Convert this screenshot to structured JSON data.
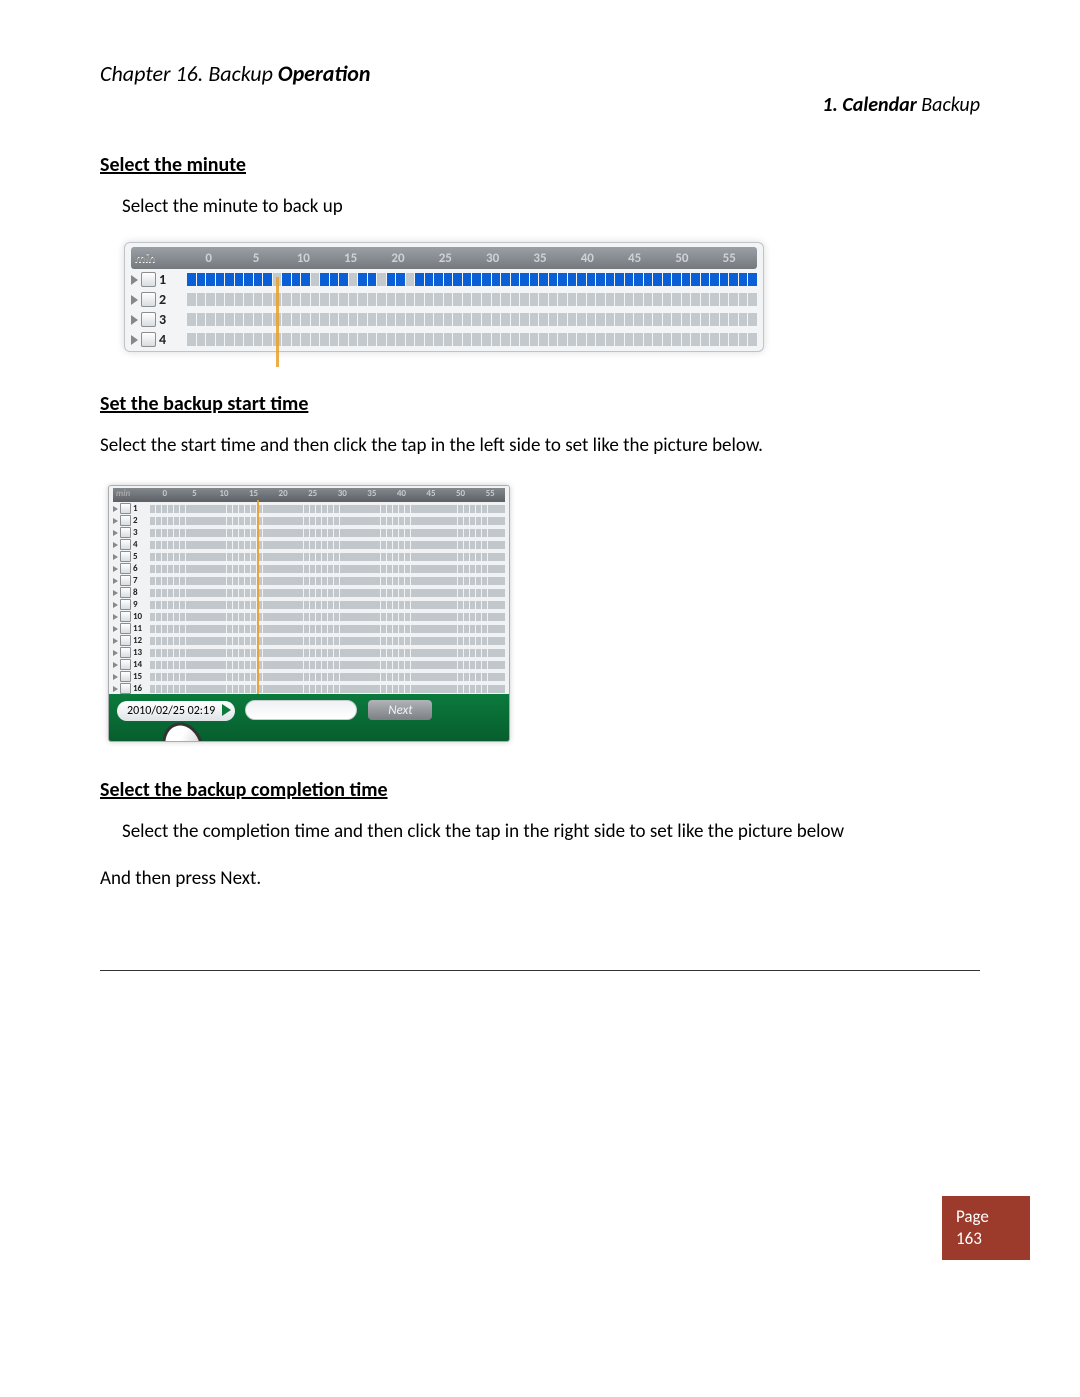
{
  "header": {
    "chapter_prefix": "Chapter 16. Backup ",
    "chapter_bold": "Operation",
    "section_bold": "1. Calendar",
    "section_suffix": " Backup"
  },
  "sections": {
    "s1": {
      "heading": "Select the minute",
      "body": "Select the minute to back up"
    },
    "s2": {
      "heading": "Set the backup start time",
      "body": "Select the start time and then click the tap in the left side to set like the picture below."
    },
    "s3": {
      "heading": "Select the backup completion time",
      "body1": "Select the completion time and then click the tap in the right side to set like the picture below",
      "body2": "And then press Next."
    }
  },
  "fig1": {
    "min_label": "min",
    "ticks": [
      "0",
      "5",
      "10",
      "15",
      "20",
      "25",
      "30",
      "35",
      "40",
      "45",
      "50",
      "55"
    ],
    "rows": [
      "1",
      "2",
      "3",
      "4"
    ]
  },
  "fig2": {
    "min_label": "min",
    "ticks": [
      "0",
      "5",
      "10",
      "15",
      "20",
      "25",
      "30",
      "35",
      "40",
      "45",
      "50",
      "55"
    ],
    "rows": [
      "1",
      "2",
      "3",
      "4",
      "5",
      "6",
      "7",
      "8",
      "9",
      "10",
      "11",
      "12",
      "13",
      "14",
      "15",
      "16"
    ],
    "timestamp": "2010/02/25  02:19",
    "next_label": "Next"
  },
  "footer": {
    "page_label": "Page",
    "page_num": "163"
  }
}
